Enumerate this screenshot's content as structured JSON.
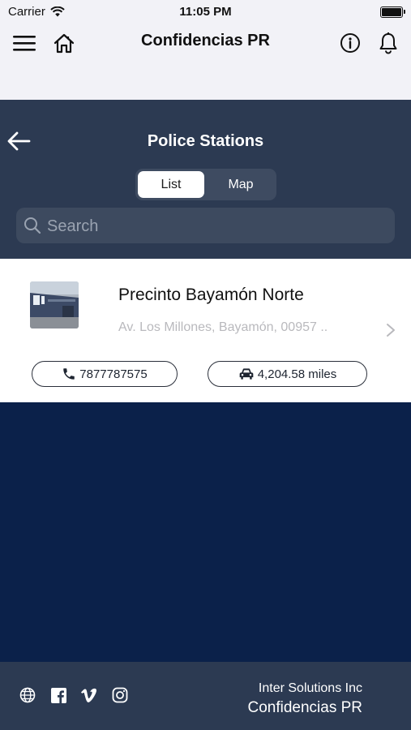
{
  "status_bar": {
    "carrier": "Carrier",
    "time": "11:05 PM"
  },
  "top_nav": {
    "title": "Confidencias PR"
  },
  "header": {
    "title": "Police Stations"
  },
  "view_toggle": {
    "list_label": "List",
    "map_label": "Map",
    "selected": "List"
  },
  "search": {
    "placeholder": "Search",
    "value": ""
  },
  "stations": [
    {
      "name": "Precinto Bayamón Norte",
      "address": "Av. Los Millones, Bayamón, 00957 ..",
      "phone": "7877787575",
      "distance": "4,204.58 miles"
    }
  ],
  "footer": {
    "company": "Inter Solutions Inc",
    "app_name": "Confidencias PR",
    "social_icons": [
      "globe-icon",
      "facebook-icon",
      "vimeo-icon",
      "instagram-icon"
    ]
  },
  "colors": {
    "top_bar": "#f2f2f7",
    "header": "#2c3a52",
    "body": "#0b214a",
    "card": "#ffffff"
  }
}
